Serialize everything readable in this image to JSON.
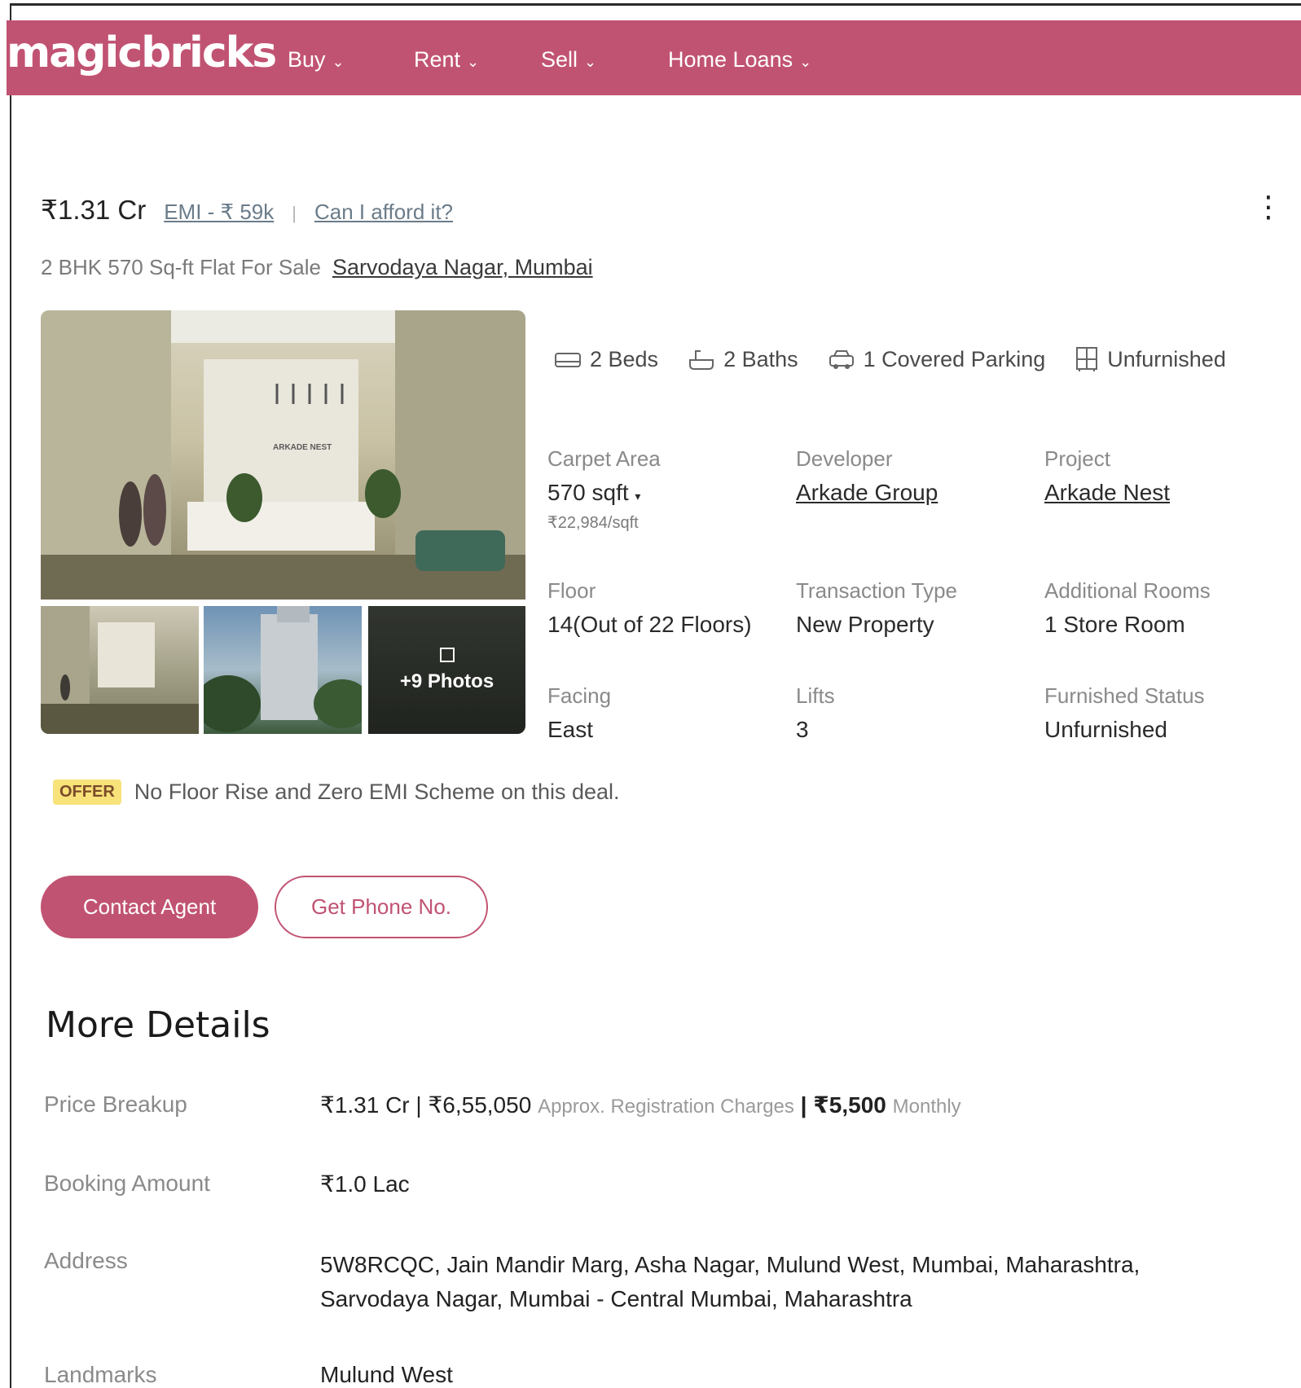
{
  "header": {
    "logo": "magicbricks",
    "nav": [
      {
        "label": "Buy"
      },
      {
        "label": "Rent"
      },
      {
        "label": "Sell"
      },
      {
        "label": "Home Loans"
      }
    ],
    "brand_color": "#c15372"
  },
  "listing": {
    "price": "₹1.31 Cr",
    "emi_link": "EMI - ₹ 59k",
    "separator": "|",
    "afford_link": "Can I afford it?",
    "title": "2 BHK 570 Sq-ft Flat For Sale",
    "location": "Sarvodaya Nagar, Mumbai",
    "more_menu_icon": "⋮"
  },
  "gallery": {
    "brand_sign": "ARKADE NEST",
    "more_photos": "+9 Photos"
  },
  "amenities": [
    {
      "icon": "bed-icon",
      "label": "2 Beds"
    },
    {
      "icon": "bath-icon",
      "label": "2 Baths"
    },
    {
      "icon": "car-icon",
      "label": "1 Covered Parking"
    },
    {
      "icon": "wardrobe-icon",
      "label": "Unfurnished"
    }
  ],
  "specs": {
    "carpet_area": {
      "label": "Carpet Area",
      "value": "570 sqft",
      "sub": "₹22,984/sqft"
    },
    "developer": {
      "label": "Developer",
      "value": "Arkade Group"
    },
    "project": {
      "label": "Project",
      "value": "Arkade Nest"
    },
    "floor": {
      "label": "Floor",
      "value": "14(Out of 22 Floors)"
    },
    "transaction": {
      "label": "Transaction Type",
      "value": "New Property"
    },
    "additional_rooms": {
      "label": "Additional Rooms",
      "value": "1 Store Room"
    },
    "facing": {
      "label": "Facing",
      "value": "East"
    },
    "lifts": {
      "label": "Lifts",
      "value": "3"
    },
    "furnished": {
      "label": "Furnished Status",
      "value": "Unfurnished"
    }
  },
  "offer": {
    "badge": "OFFER",
    "text": "No Floor Rise and Zero EMI Scheme on this deal."
  },
  "actions": {
    "contact_agent": "Contact Agent",
    "get_phone": "Get Phone No."
  },
  "more_details": {
    "title": "More Details",
    "price_breakup": {
      "label": "Price Breakup",
      "price": "₹1.31 Cr | ₹6,55,050",
      "registration_note": "Approx. Registration Charges",
      "monthly_amount": "| ₹5,500",
      "monthly_note": "Monthly"
    },
    "booking_amount": {
      "label": "Booking Amount",
      "value": "₹1.0 Lac"
    },
    "address": {
      "label": "Address",
      "line1": "5W8RCQC, Jain Mandir Marg, Asha Nagar, Mulund West, Mumbai, Maharashtra,",
      "line2": "Sarvodaya Nagar, Mumbai - Central Mumbai, Maharashtra"
    },
    "landmarks": {
      "label": "Landmarks",
      "value": "Mulund West"
    }
  }
}
